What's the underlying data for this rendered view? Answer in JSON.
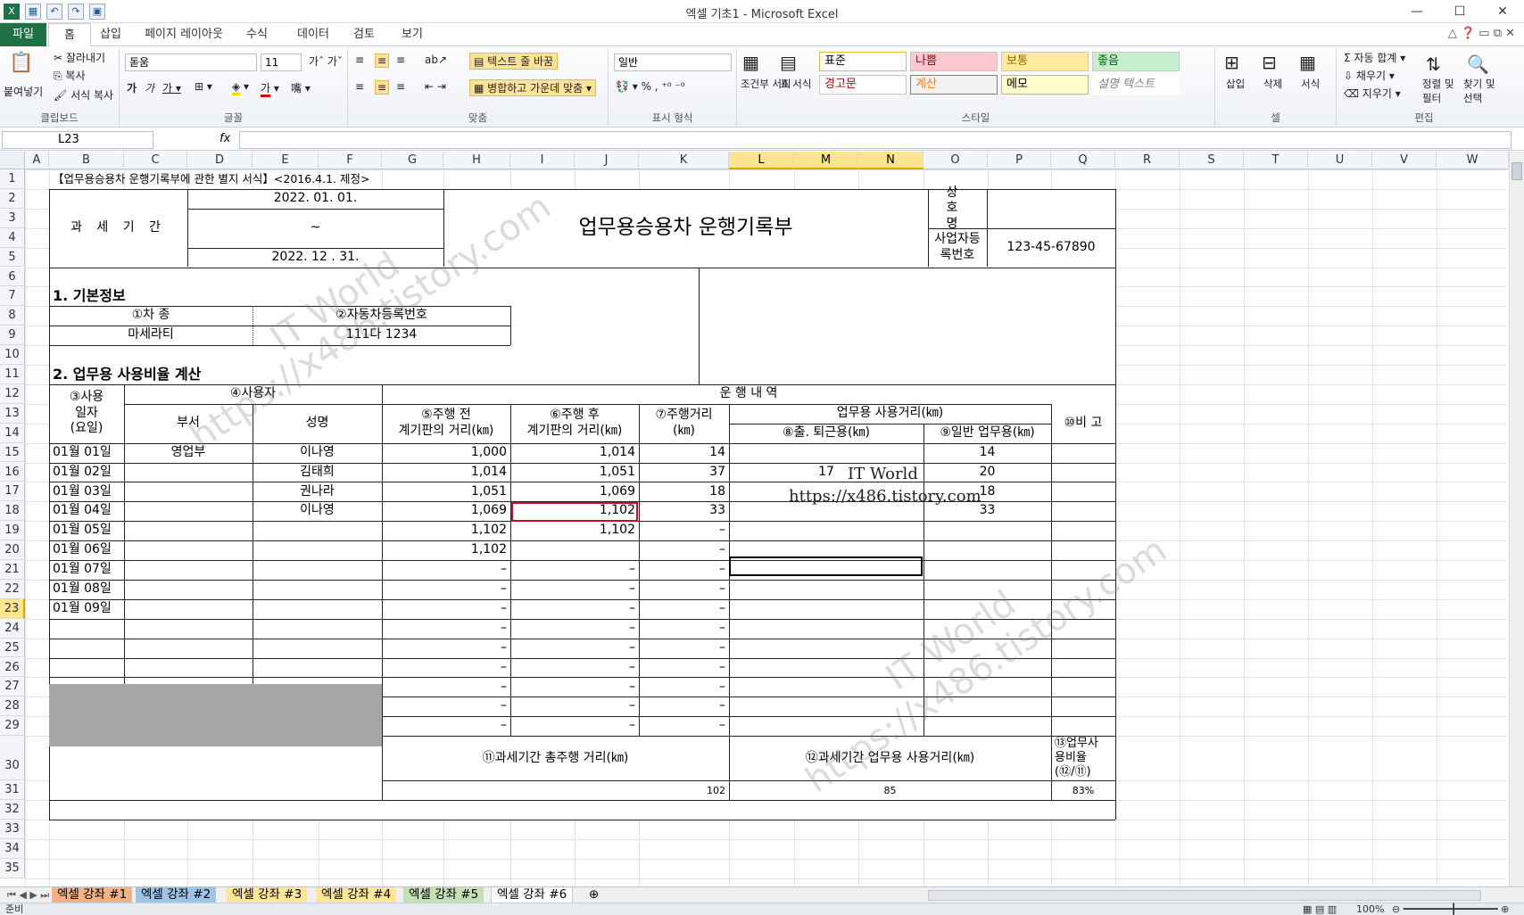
{
  "app": {
    "title": "엑셀 기초1 - Microsoft Excel"
  },
  "tabs": [
    "파일",
    "홈",
    "삽입",
    "페이지 레이아웃",
    "수식",
    "데이터",
    "검토",
    "보기"
  ],
  "ribbon": {
    "clipboard": {
      "paste": "붙여넣기",
      "cut": "잘라내기",
      "copy": "복사",
      "format_painter": "서식 복사",
      "label": "클립보드"
    },
    "font": {
      "name": "돋움",
      "size": "11",
      "label": "글꼴"
    },
    "align": {
      "wrap": "텍스트 줄 바꿈",
      "merge": "병합하고 가운데 맞춤",
      "label": "맞춤"
    },
    "number": {
      "format": "일반",
      "label": "표시 형식"
    },
    "styles": {
      "cond": "조건부 서식",
      "table": "표 서식",
      "cells": [
        "표준",
        "나쁨",
        "보통",
        "좋음",
        "경고문",
        "계산",
        "메모",
        "설명 텍스트"
      ],
      "label": "스타일"
    },
    "cells": {
      "insert": "삽입",
      "delete": "삭제",
      "format": "서식",
      "label": "셀"
    },
    "edit": {
      "autosum": "자동 합계",
      "fill": "채우기",
      "clear": "지우기",
      "sort": "정렬 및 필터",
      "find": "찾기 및 선택",
      "label": "편집"
    }
  },
  "namebox": "L23",
  "columns": [
    "A",
    "B",
    "C",
    "D",
    "E",
    "F",
    "G",
    "H",
    "I",
    "J",
    "K",
    "L",
    "M",
    "N",
    "O",
    "P",
    "Q",
    "R",
    "S",
    "T",
    "U",
    "V",
    "W"
  ],
  "rows": [
    "1",
    "2",
    "3",
    "4",
    "5",
    "6",
    "7",
    "8",
    "9",
    "10",
    "11",
    "12",
    "13",
    "14",
    "15",
    "16",
    "17",
    "18",
    "19",
    "20",
    "21",
    "22",
    "23",
    "24",
    "25",
    "26",
    "27",
    "28",
    "29",
    "30",
    "31",
    "32",
    "33",
    "34",
    "35"
  ],
  "sheet": {
    "header_note": "【업무용승용차 운행기록부에 관한 별지 서식】<2016.4.1. 제정>",
    "period_label": "과 세 기 간",
    "period_start": "2022. 01. 01.",
    "period_tilde": "~",
    "period_end": "2022. 12 . 31.",
    "main_title": "업무용승용차 운행기록부",
    "company_label": "상 호 명",
    "bizno_label": "사업자등록번호",
    "bizno": "123-45-67890",
    "sec1": "1. 기본정보",
    "car_type_label": "①차 종",
    "car_no_label": "②자동차등록번호",
    "car_type": "마세라티",
    "car_no": "111다 1234",
    "sec2": "2. 업무용 사용비율 계산",
    "h_date": "③사용\n일자\n(요일)",
    "h_user": "④사용자",
    "h_drive": "운 행    내 역",
    "h_dept": "부서",
    "h_name": "성명",
    "h_before": "⑤주행 전\n계기판의 거리(㎞)",
    "h_after": "⑥주행 후\n계기판의 거리(㎞)",
    "h_dist": "⑦주행거리\n(㎞)",
    "h_biz": "업무용 사용거리(㎞)",
    "h_commute": "⑧출. 퇴근용(㎞)",
    "h_general": "⑨일반 업무용(㎞)",
    "h_note": "⑩비 고",
    "rows": [
      {
        "date": "01월 01일",
        "dept": "영업부",
        "name": "이나영",
        "before": "1,000",
        "after": "1,014",
        "dist": "14",
        "commute": "",
        "general": "14"
      },
      {
        "date": "01월 02일",
        "dept": "",
        "name": "김태희",
        "before": "1,014",
        "after": "1,051",
        "dist": "37",
        "commute": "17",
        "general": "20"
      },
      {
        "date": "01월 03일",
        "dept": "",
        "name": "권나라",
        "before": "1,051",
        "after": "1,069",
        "dist": "18",
        "commute": "",
        "general": "18"
      },
      {
        "date": "01월 04일",
        "dept": "",
        "name": "이나영",
        "before": "1,069",
        "after": "1,102",
        "dist": "33",
        "commute": "",
        "general": "33"
      },
      {
        "date": "01월 05일",
        "dept": "",
        "name": "",
        "before": "1,102",
        "after": "1,102",
        "dist": "–",
        "commute": "",
        "general": ""
      },
      {
        "date": "01월 06일",
        "dept": "",
        "name": "",
        "before": "1,102",
        "after": "",
        "dist": "–",
        "commute": "",
        "general": ""
      },
      {
        "date": "01월 07일",
        "dept": "",
        "name": "",
        "before": "–",
        "after": "–",
        "dist": "–",
        "commute": "",
        "general": ""
      },
      {
        "date": "01월 08일",
        "dept": "",
        "name": "",
        "before": "–",
        "after": "–",
        "dist": "–",
        "commute": "",
        "general": ""
      },
      {
        "date": "01월 09일",
        "dept": "",
        "name": "",
        "before": "–",
        "after": "–",
        "dist": "–",
        "commute": "",
        "general": ""
      },
      {
        "date": "",
        "dept": "",
        "name": "",
        "before": "–",
        "after": "–",
        "dist": "–",
        "commute": "",
        "general": ""
      },
      {
        "date": "",
        "dept": "",
        "name": "",
        "before": "–",
        "after": "–",
        "dist": "–",
        "commute": "",
        "general": ""
      },
      {
        "date": "",
        "dept": "",
        "name": "",
        "before": "–",
        "after": "–",
        "dist": "–",
        "commute": "",
        "general": ""
      },
      {
        "date": "",
        "dept": "",
        "name": "",
        "before": "–",
        "after": "–",
        "dist": "–",
        "commute": "",
        "general": ""
      },
      {
        "date": "",
        "dept": "",
        "name": "",
        "before": "–",
        "after": "–",
        "dist": "–",
        "commute": "",
        "general": ""
      },
      {
        "date": "",
        "dept": "",
        "name": "",
        "before": "–",
        "after": "–",
        "dist": "–",
        "commute": "",
        "general": ""
      }
    ],
    "total_label": "⑪과세기간 총주행 거리(㎞)",
    "biz_total_label": "⑫과세기간 업무용 사용거리(㎞)",
    "ratio_label": "⑬업무사\n용비율\n(⑫/⑪)",
    "total": "102",
    "biz_total": "85",
    "ratio": "83%",
    "wm_text1": "IT World",
    "wm_url1": "https://x486.tistory.com"
  },
  "sheet_tabs": [
    "엑셀 강좌 #1",
    "엑셀 강좌 #2",
    "엑셀 강좌 #3",
    "엑셀 강좌 #4",
    "엑셀 강좌 #5",
    "엑셀 강좌 #6"
  ],
  "status": {
    "ready": "준비",
    "zoom": "100%"
  }
}
